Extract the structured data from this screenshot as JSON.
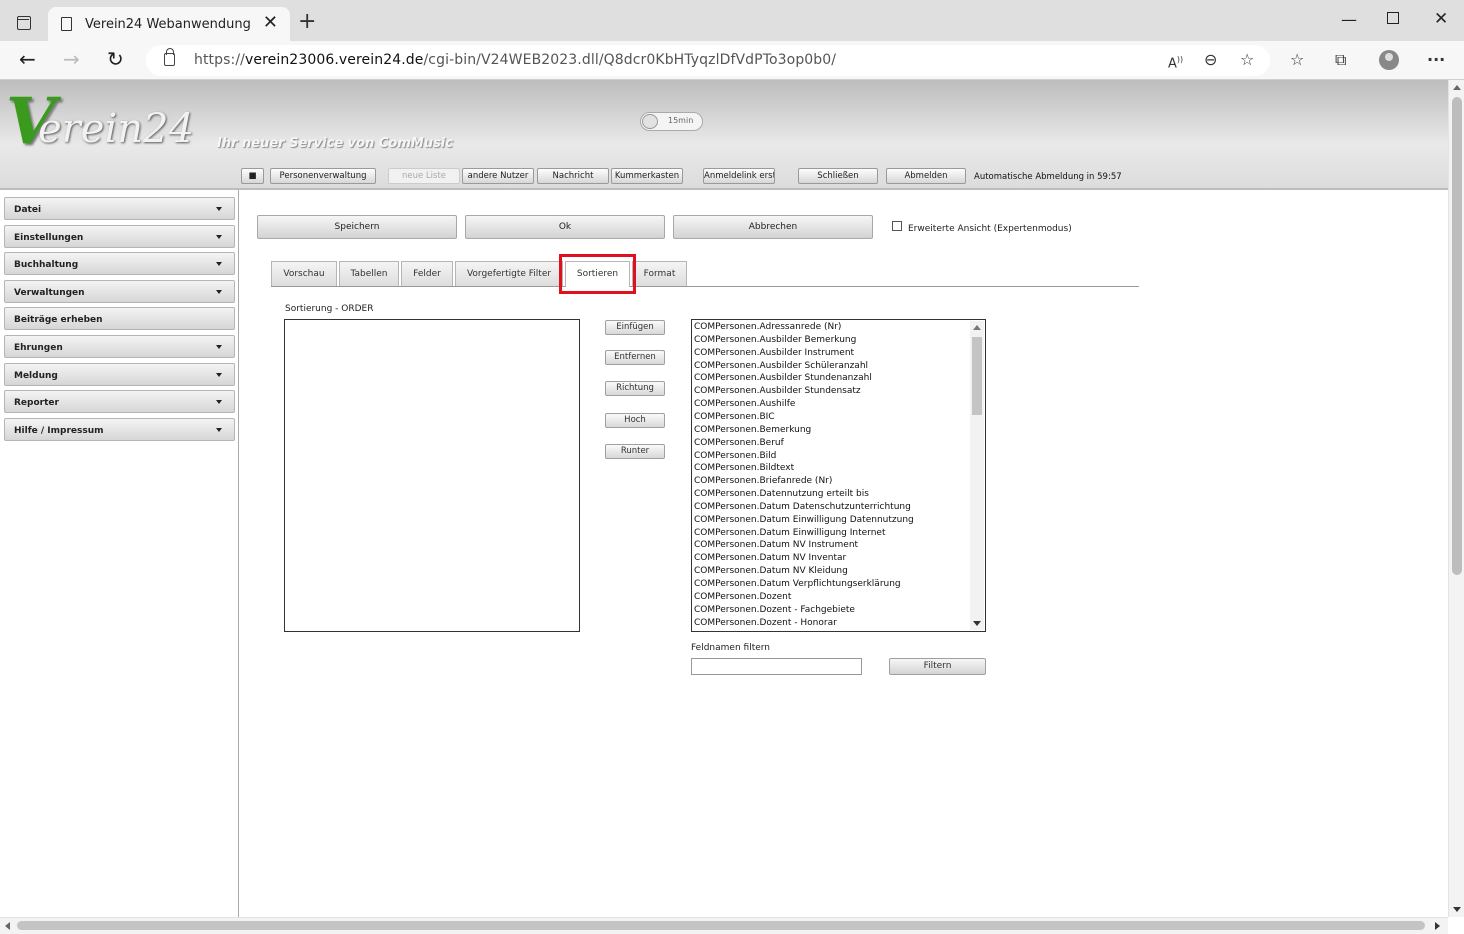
{
  "browser": {
    "tab_title": "Verein24 Webanwendung",
    "url_prefix": "https://",
    "url_domain": "verein23006.verein24.de",
    "url_path": "/cgi-bin/V24WEB2023.dll/Q8dcr0KbHTyqzlDfVdPTo3op0b0/"
  },
  "header": {
    "logo": "Verein24",
    "logo_v": "V",
    "logo_rest": "erein24",
    "slogan": "Ihr neuer Service von ComMusic",
    "timer": "15min"
  },
  "toolbar": {
    "personen": "Personenverwaltung",
    "neue_liste": "neue Liste",
    "andere_nutzer": "andere Nutzer",
    "nachricht": "Nachricht",
    "kummerkasten": "Kummerkasten",
    "anmeldelink": "Anmeldelink erst",
    "schliessen": "Schließen",
    "abmelden": "Abmelden",
    "auto_logout": "Automatische Abmeldung in 59:57"
  },
  "sidebar": {
    "items": [
      {
        "label": "Datei"
      },
      {
        "label": "Einstellungen"
      },
      {
        "label": "Buchhaltung"
      },
      {
        "label": "Verwaltungen"
      },
      {
        "label": "Beiträge erheben"
      },
      {
        "label": "Ehrungen"
      },
      {
        "label": "Meldung"
      },
      {
        "label": "Reporter"
      },
      {
        "label": "Hilfe / Impressum"
      }
    ]
  },
  "actions": {
    "save": "Speichern",
    "ok": "Ok",
    "cancel": "Abbrechen",
    "expert_mode": "Erweiterte Ansicht (Expertenmodus)"
  },
  "tabs": [
    "Vorschau",
    "Tabellen",
    "Felder",
    "Vorgefertigte Filter",
    "Sortieren",
    "Format"
  ],
  "active_tab": "Sortieren",
  "sort": {
    "label": "Sortierung - ORDER",
    "buttons": [
      "Einfügen",
      "Entfernen",
      "Richtung",
      "Hoch",
      "Runter"
    ],
    "fields": [
      "COMPersonen.Adressanrede (Nr)",
      "COMPersonen.Ausbilder Bemerkung",
      "COMPersonen.Ausbilder Instrument",
      "COMPersonen.Ausbilder Schüleranzahl",
      "COMPersonen.Ausbilder Stundenanzahl",
      "COMPersonen.Ausbilder Stundensatz",
      "COMPersonen.Aushilfe",
      "COMPersonen.BIC",
      "COMPersonen.Bemerkung",
      "COMPersonen.Beruf",
      "COMPersonen.Bild",
      "COMPersonen.Bildtext",
      "COMPersonen.Briefanrede (Nr)",
      "COMPersonen.Datennutzung erteilt bis",
      "COMPersonen.Datum Datenschutzunterrichtung",
      "COMPersonen.Datum Einwilligung Datennutzung",
      "COMPersonen.Datum Einwilligung Internet",
      "COMPersonen.Datum NV Instrument",
      "COMPersonen.Datum NV Inventar",
      "COMPersonen.Datum NV Kleidung",
      "COMPersonen.Datum Verpflichtungserklärung",
      "COMPersonen.Dozent",
      "COMPersonen.Dozent - Fachgebiete",
      "COMPersonen.Dozent - Honorar"
    ],
    "filter_label": "Feldnamen filtern",
    "filter_value": "",
    "filter_button": "Filtern"
  },
  "colors": {
    "highlight": "#e0101f",
    "logo_green": "#3a9a1e"
  }
}
